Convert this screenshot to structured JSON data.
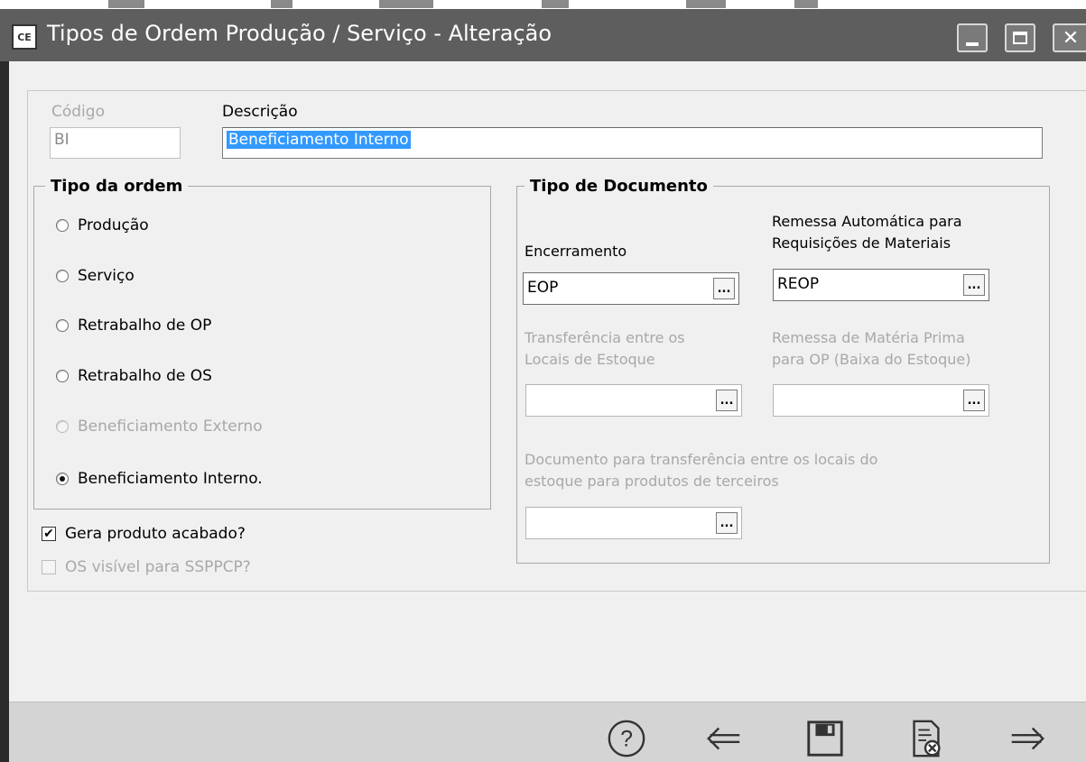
{
  "window": {
    "icon_text": "CE",
    "title": "Tipos de Ordem Produção / Serviço - Alteração"
  },
  "form": {
    "codigo_label": "Código",
    "codigo_value": "BI",
    "descricao_label": "Descrição",
    "descricao_value": "Beneficiamento Interno"
  },
  "tipo_ordem": {
    "legend": "Tipo da ordem",
    "options": [
      {
        "label": "Produção",
        "selected": false,
        "enabled": true
      },
      {
        "label": "Serviço",
        "selected": false,
        "enabled": true
      },
      {
        "label": "Retrabalho de OP",
        "selected": false,
        "enabled": true
      },
      {
        "label": "Retrabalho de OS",
        "selected": false,
        "enabled": true
      },
      {
        "label": "Beneficiamento Externo",
        "selected": false,
        "enabled": false
      },
      {
        "label": "Beneficiamento Interno.",
        "selected": true,
        "enabled": true
      }
    ]
  },
  "checks": {
    "gera_produto": {
      "label": "Gera produto acabado?",
      "checked": true,
      "mark": "✔"
    },
    "os_visivel": {
      "label": "OS visível para SSPPCP?",
      "checked": false
    }
  },
  "tipo_documento": {
    "legend": "Tipo de Documento",
    "encerramento_label": "Encerramento",
    "encerramento_value": "EOP",
    "remessa_auto_label_1": "Remessa Automática para",
    "remessa_auto_label_2": "Requisições de Materiais",
    "remessa_auto_value": "REOP",
    "transferencia_label_1": "Transferência entre os",
    "transferencia_label_2": "Locais de Estoque",
    "transferencia_value": "",
    "remessa_mp_label_1": "Remessa de Matéria Prima",
    "remessa_mp_label_2": "para OP (Baixa do Estoque)",
    "remessa_mp_value": "",
    "doc_terceiros_label_1": "Documento para transferência entre os locais do",
    "doc_terceiros_label_2": "estoque para produtos de terceiros",
    "doc_terceiros_value": "",
    "ellipsis": "..."
  },
  "toolbar": {
    "help": "help-icon",
    "back": "arrow-left-icon",
    "save": "save-icon",
    "cancel": "cancel-document-icon",
    "forward": "arrow-right-icon"
  },
  "colors": {
    "titlebar": "#5e5e5e",
    "selection": "#3399ff",
    "disabled_text": "#a8a8a8"
  }
}
